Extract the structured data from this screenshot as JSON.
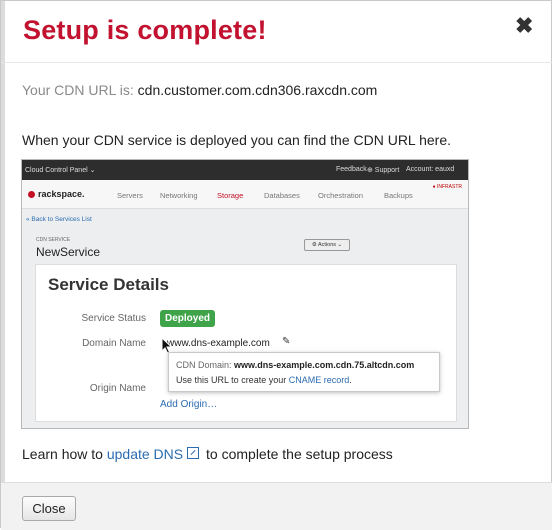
{
  "dialog": {
    "title": "Setup is complete!",
    "close_glyph": "✖",
    "cdn_url_label": "Your CDN URL is:",
    "cdn_url_value": "cdn.customer.com.cdn306.raxcdn.com",
    "deploy_text": "When your CDN service is deployed you can find the CDN URL here.",
    "learn_prefix": "Learn how to",
    "learn_link": "update DNS",
    "learn_suffix": "to complete the setup process",
    "close_button": "Close"
  },
  "screenshot": {
    "topbar": {
      "left": "Cloud Control Panel ⌄",
      "feedback": "Feedback",
      "support": "⊕ Support",
      "account": "Account: eauxd"
    },
    "logo": "rackspace.",
    "nav": [
      "Servers",
      "Networking",
      "Storage",
      "Databases",
      "Orchestration",
      "Backups"
    ],
    "active_nav": "Storage",
    "infra": "INFRASTR",
    "back_link": "« Back to Services List",
    "service_label": "CDN SERVICE",
    "service_name": "NewService",
    "actions": "⚙ Actions ⌄",
    "panel_title": "Service Details",
    "status_label": "Service Status",
    "status_value": "Deployed",
    "domain_label": "Domain Name",
    "domain_value": "www.dns-example.com",
    "origin_label": "Origin Name",
    "add_origin": "Add Origin…",
    "popover_label": "CDN Domain:",
    "popover_domain": "www.dns-example.com.cdn.75.altcdn.com",
    "popover_text": "Use this URL to create your",
    "popover_link": "CNAME record",
    "popover_end": "."
  },
  "colors": {
    "title": "#c2122f",
    "link": "#2b6cb0",
    "deployed": "#3fa34a"
  },
  "icons": {
    "close": "close-icon",
    "external": "external-link-icon",
    "pencil": "pencil-icon",
    "cursor": "mouse-cursor-icon"
  }
}
